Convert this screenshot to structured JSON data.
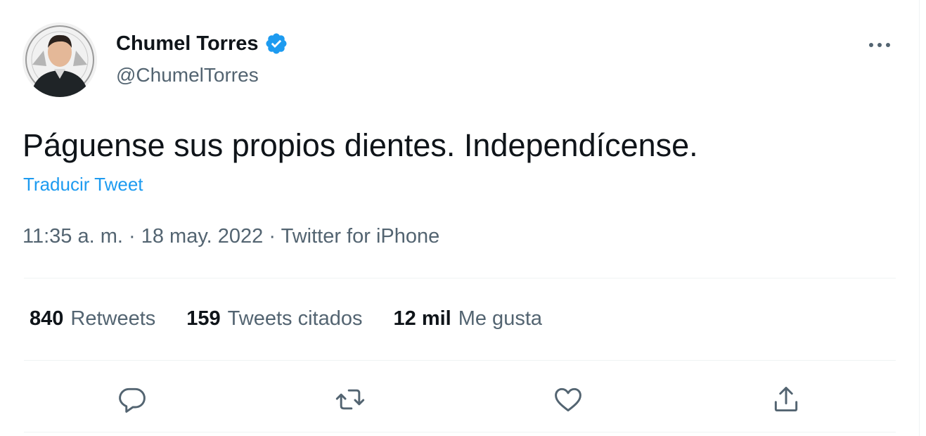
{
  "author": {
    "display_name": "Chumel Torres",
    "handle": "@ChumelTorres",
    "avatar_icon": "profile-photo",
    "verified_icon": "verified-badge-icon",
    "verified_color": "#1d9bf0"
  },
  "more_icon": "more-options-icon",
  "tweet": {
    "text": "Páguense sus propios dientes. Independícense.",
    "translate_label": "Traducir Tweet",
    "time": "11:35 a. m.",
    "separator": "·",
    "date": "18 may. 2022",
    "source": "Twitter for iPhone"
  },
  "stats": {
    "retweets_count": "840",
    "retweets_label": "Retweets",
    "quotes_count": "159",
    "quotes_label": "Tweets citados",
    "likes_count": "12 mil",
    "likes_label": "Me gusta"
  },
  "actions": [
    {
      "icon": "reply-icon"
    },
    {
      "icon": "retweet-icon"
    },
    {
      "icon": "like-icon"
    },
    {
      "icon": "share-icon"
    }
  ],
  "colors": {
    "text_primary": "#0f1419",
    "text_secondary": "#536471",
    "accent": "#1d9bf0",
    "divider": "#eff3f4"
  }
}
